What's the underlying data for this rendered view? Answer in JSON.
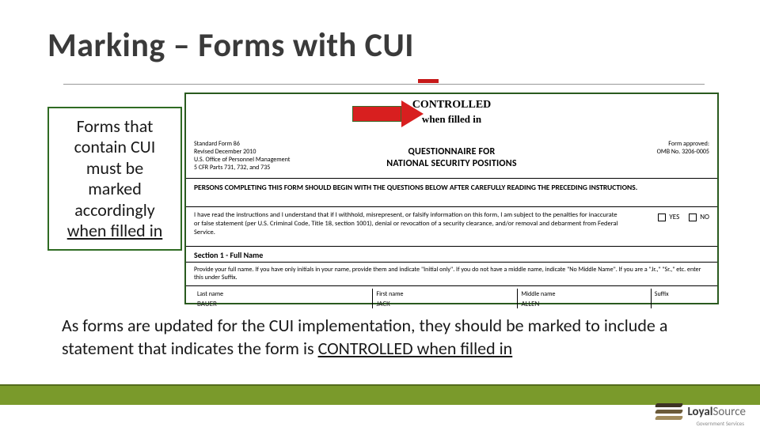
{
  "title": "Marking –  Forms with CUI",
  "callout": {
    "line1": "Forms that",
    "line2": "contain CUI",
    "line3": "must be",
    "line4": "marked",
    "line5": "accordingly",
    "line6": "when filled in"
  },
  "form": {
    "controlled": "CONTROLLED",
    "when_filled": "when filled in",
    "meta_left": {
      "l1": "Standard Form 86",
      "l2": "Revised December 2010",
      "l3": "U.S. Office of Personnel Management",
      "l4": "5 CFR Parts 731, 732, and 735"
    },
    "meta_right": {
      "l1": "Form approved:",
      "l2": "OMB No. 3206-0005"
    },
    "header_l1": "QUESTIONNAIRE FOR",
    "header_l2": "NATIONAL SECURITY POSITIONS",
    "banner": "PERSONS COMPLETING THIS FORM SHOULD BEGIN WITH THE QUESTIONS BELOW AFTER CAREFULLY READING THE PRECEDING INSTRUCTIONS.",
    "ack": "I have read the instructions and I understand that if I withhold, misrepresent, or falsify information on this form, I am subject to the penalties for inaccurate or false statement (per U.S. Criminal Code, Title 18, section 1001), denial or revocation of a security clearance, and/or removal and debarment from Federal Service.",
    "yes": "YES",
    "no": "NO",
    "section1": "Section 1 - Full Name",
    "instr": "Provide your full name. If you have only initials in your name, provide them and indicate \"Initial only\". If you do not have a middle name, indicate \"No Middle Name\". If you are a \"Jr.,\" \"Sr.,\" etc. enter this under Suffix.",
    "labels": {
      "last": "Last name",
      "first": "First name",
      "middle": "Middle name",
      "suffix": "Suffix"
    },
    "values": {
      "last": "BAUER",
      "first": "JACK",
      "middle": "ALLEN",
      "suffix": ""
    }
  },
  "bottom": {
    "pre": "As forms are updated for the CUI implementation, they should be marked to include a statement that indicates the form is ",
    "u": "CONTROLLED when filled in"
  },
  "brand": {
    "bold": "Loyal",
    "light": "Source",
    "sub": "Government Services"
  }
}
